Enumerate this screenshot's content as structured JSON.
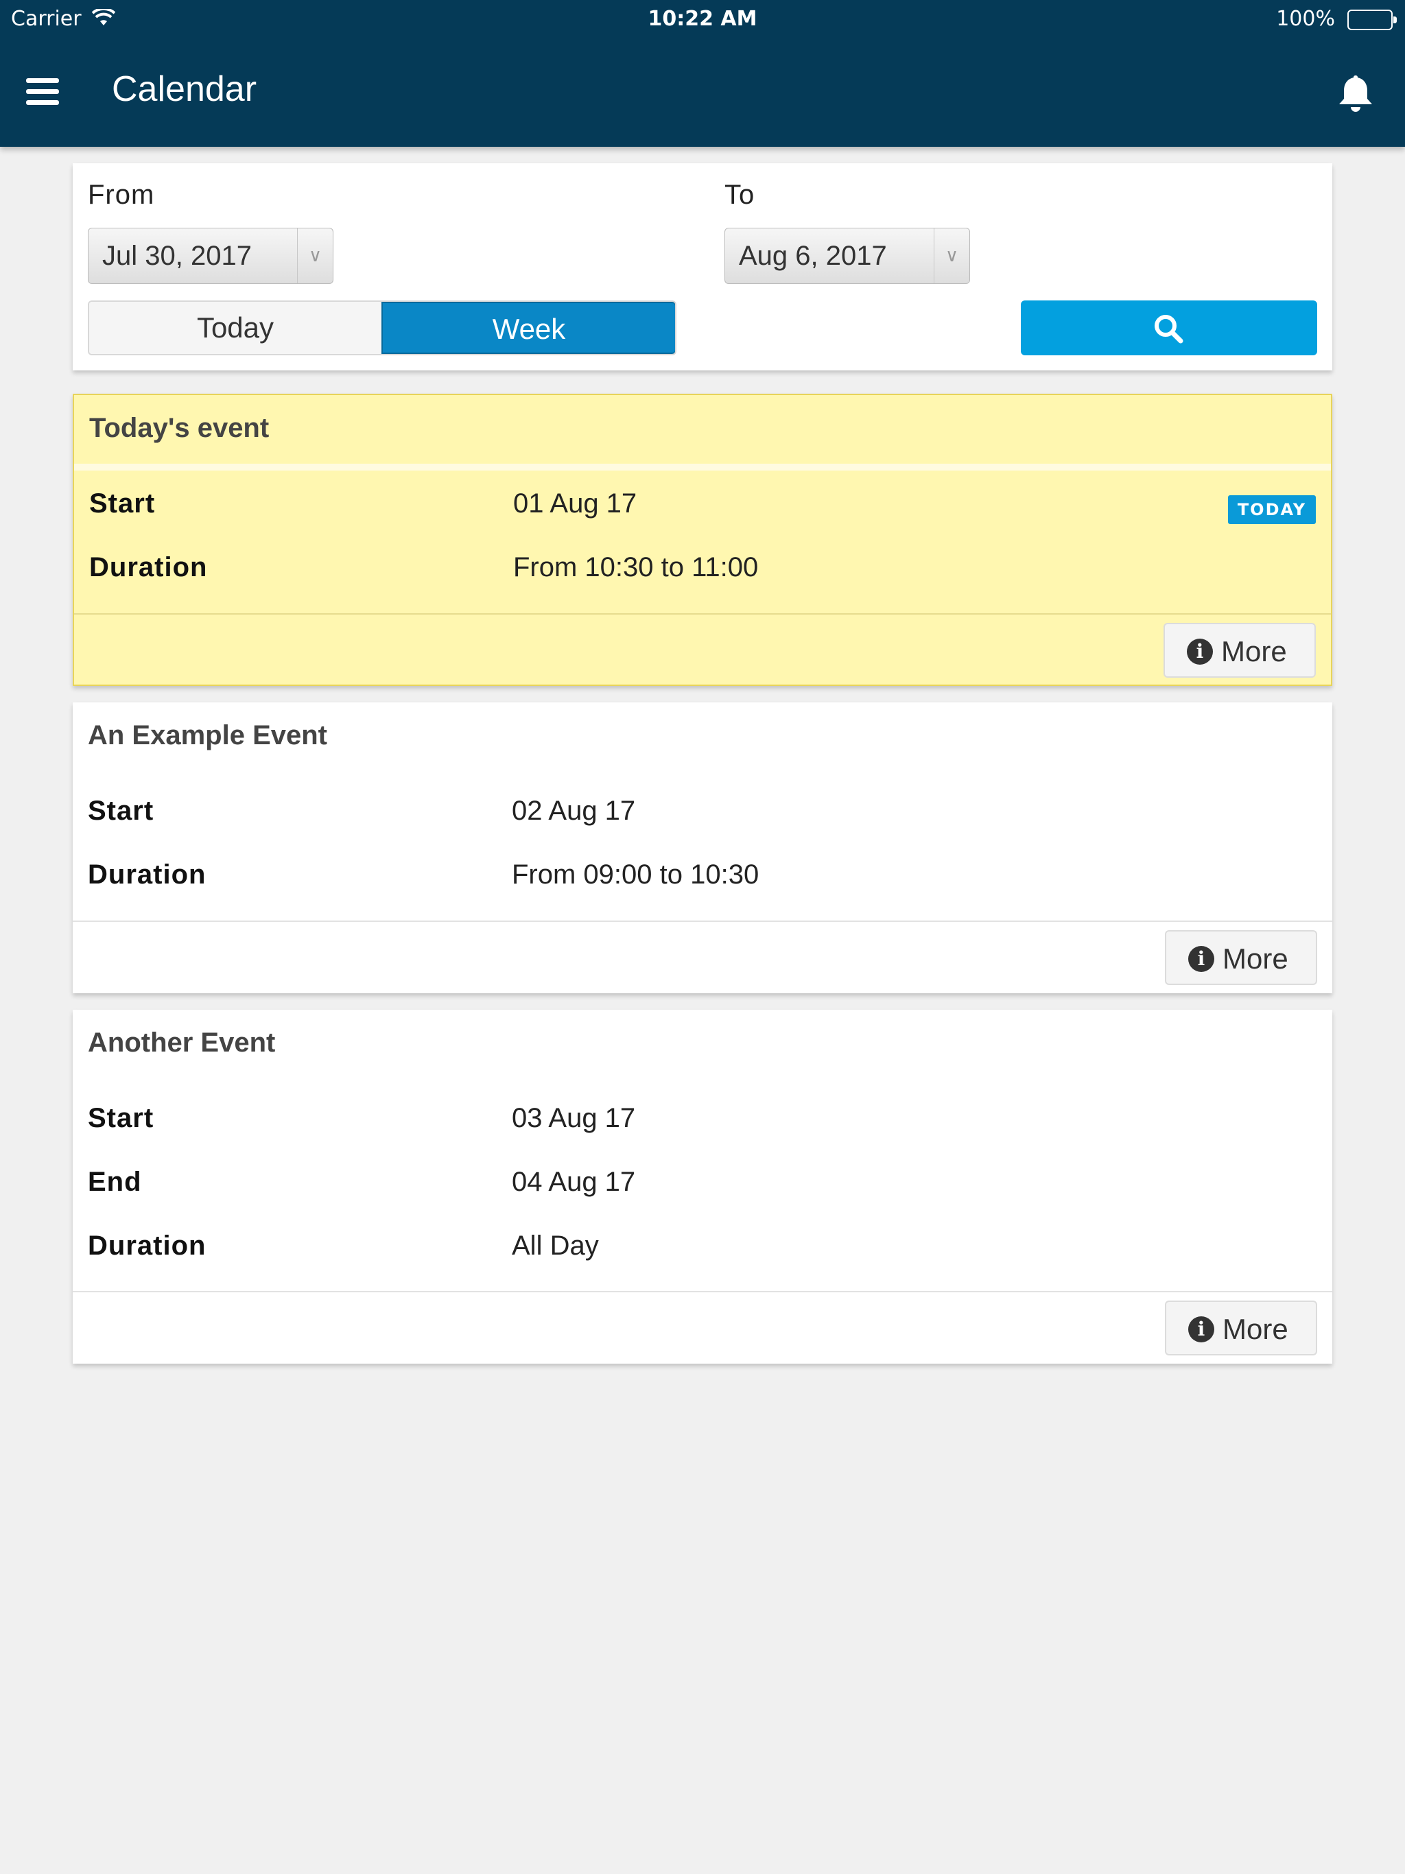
{
  "status_bar": {
    "carrier": "Carrier",
    "time": "10:22 AM",
    "battery": "100%"
  },
  "nav": {
    "title": "Calendar",
    "menu_icon": "hamburger-menu-icon",
    "bell_icon": "bell-icon"
  },
  "filter": {
    "from_label": "From",
    "from_value": "Jul 30, 2017",
    "to_label": "To",
    "to_value": "Aug 6, 2017",
    "segments": [
      "Today",
      "Week"
    ],
    "selected_segment": "Week",
    "search_icon": "search-icon"
  },
  "events": [
    {
      "title": "Today's event",
      "badge": "TODAY",
      "rows": [
        {
          "label": "Start",
          "value": "01 Aug 17"
        },
        {
          "label": "Duration",
          "value": "From 10:30 to 11:00"
        }
      ],
      "more_label": "More"
    },
    {
      "title": "An Example Event",
      "rows": [
        {
          "label": "Start",
          "value": "02 Aug 17"
        },
        {
          "label": "Duration",
          "value": "From 09:00 to 10:30"
        }
      ],
      "more_label": "More"
    },
    {
      "title": "Another Event",
      "rows": [
        {
          "label": "Start",
          "value": "03 Aug 17"
        },
        {
          "label": "End",
          "value": "04 Aug 17"
        },
        {
          "label": "Duration",
          "value": "All Day"
        }
      ],
      "more_label": "More"
    }
  ],
  "colors": {
    "nav_bg": "#053a57",
    "accent": "#03a0df",
    "today_bg": "#fff7b0"
  }
}
